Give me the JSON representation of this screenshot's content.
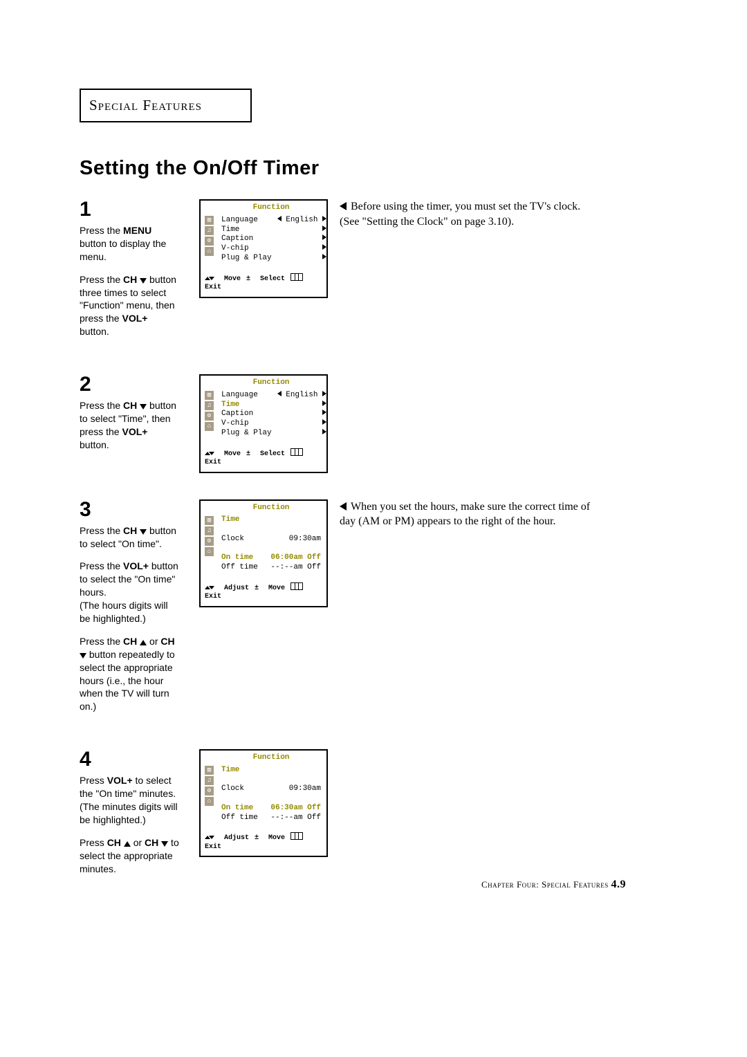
{
  "header": "Special Features",
  "title": "Setting the On/Off Timer",
  "footer": {
    "prefix": "Chapter Four: Special Features ",
    "page": "4.9"
  },
  "sidenotes": {
    "s1": "Before using the timer, you must set the TV's clock. (See \"Setting the Clock\" on page 3.10).",
    "s3": "When you set the hours, make sure the correct time of day (AM or PM) appears to the right of the hour."
  },
  "buttons": {
    "menu": "MENU",
    "ch": "CH",
    "volp": "VOL+"
  },
  "steps": [
    {
      "num": "1",
      "instr_html": "<p>Press the <b>{menu}</b> button to display the menu.</p><p>Press the <b>{ch}</b> <span class='tri-dn'></span> button three times to select \"Function\" menu, then press the <b>{volp}</b> button.</p>",
      "tv": {
        "title": "Function",
        "rows": [
          {
            "label": "Language",
            "value": "English",
            "arrows": "lr"
          },
          {
            "label": "Time",
            "value": "",
            "arrows": "r"
          },
          {
            "label": "Caption",
            "value": "",
            "arrows": "r"
          },
          {
            "label": "V-chip",
            "value": "",
            "arrows": "r"
          },
          {
            "label": "Plug & Play",
            "value": "",
            "arrows": "r"
          }
        ],
        "ft": [
          "Move",
          "Select",
          "Exit"
        ],
        "ft_sym": [
          "ud",
          "pm",
          "exit"
        ],
        "hl": null
      }
    },
    {
      "num": "2",
      "instr_html": "<p>Press the <b>{ch}</b> <span class='tri-dn'></span> button to select \"Time\", then press the <b>{volp}</b> button.</p>",
      "tv": {
        "title": "Function",
        "rows": [
          {
            "label": "Language",
            "value": "English",
            "arrows": "lr"
          },
          {
            "label": "Time",
            "value": "",
            "arrows": "r",
            "hl": true
          },
          {
            "label": "Caption",
            "value": "",
            "arrows": "r"
          },
          {
            "label": "V-chip",
            "value": "",
            "arrows": "r"
          },
          {
            "label": "Plug & Play",
            "value": "",
            "arrows": "r"
          }
        ],
        "ft": [
          "Move",
          "Select",
          "Exit"
        ],
        "ft_sym": [
          "ud",
          "pm",
          "exit"
        ]
      }
    },
    {
      "num": "3",
      "instr_html": "<p>Press the <b>{ch}</b> <span class='tri-dn'></span> button  to select \"On time\".</p><p>Press the <b>{volp}</b> button to select the \"On time\" hours.<br>(The hours digits will be highlighted.)</p><p>Press the <b>{ch}</b> <span class='tri-up'></span> or <b>{ch}</b> <span class='tri-dn'></span> button  repeatedly to select the appropriate hours (i.e., the hour when the TV will turn on.)</p>",
      "tv": {
        "title": "Function",
        "rows": [
          {
            "label": "Time",
            "value": "",
            "hl": true,
            "noarrow": true
          },
          {
            "label": "",
            "value": "",
            "blank": true
          },
          {
            "label": "Clock",
            "value": "09:30am",
            "noarrow": true
          },
          {
            "label": "",
            "value": "",
            "blank": true
          },
          {
            "label": "On time",
            "value": "06:00am Off",
            "hl": true,
            "noarrow": true
          },
          {
            "label": "Off time",
            "value": "--:--am Off",
            "noarrow": true
          }
        ],
        "ft": [
          "Adjust",
          "Move",
          "Exit"
        ],
        "ft_sym": [
          "ud",
          "pm",
          "exit"
        ]
      }
    },
    {
      "num": "4",
      "instr_html": "<p>Press <b>{volp}</b> to select the \"On time\" minutes.<br>(The minutes digits will be highlighted.)</p><p>Press <b>{ch}</b> <span class='tri-up'></span> or <b>{ch}</b> <span class='tri-dn'></span> to select the appropriate minutes.</p>",
      "tv": {
        "title": "Function",
        "rows": [
          {
            "label": "Time",
            "value": "",
            "hl": true,
            "noarrow": true
          },
          {
            "label": "",
            "value": "",
            "blank": true
          },
          {
            "label": "Clock",
            "value": "09:30am",
            "noarrow": true
          },
          {
            "label": "",
            "value": "",
            "blank": true
          },
          {
            "label": "On time",
            "value": "06:30am Off",
            "hl": true,
            "noarrow": true
          },
          {
            "label": "Off time",
            "value": "--:--am Off",
            "noarrow": true
          }
        ],
        "ft": [
          "Adjust",
          "Move",
          "Exit"
        ],
        "ft_sym": [
          "ud",
          "pm",
          "exit"
        ]
      }
    }
  ],
  "tv_icons": [
    "▥",
    "♫",
    "⚙",
    "⌂"
  ]
}
